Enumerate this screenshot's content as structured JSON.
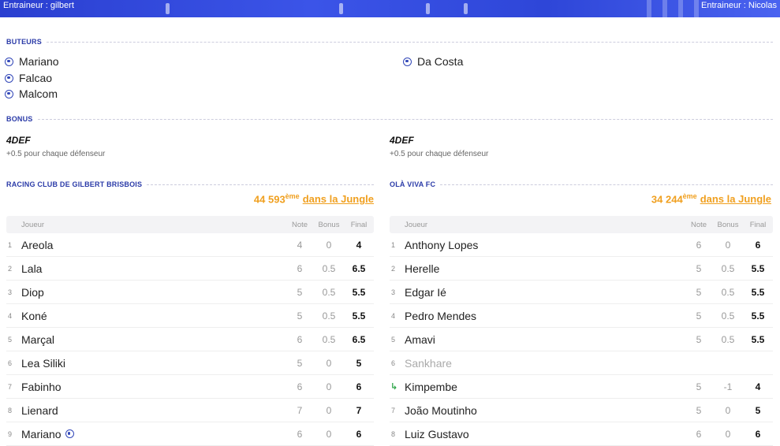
{
  "banner": {
    "coach_left": "Entraineur : gilbert",
    "coach_right": "Entraineur : Nicolas"
  },
  "sections": {
    "scorers": "BUTEURS",
    "bonus": "BONUS"
  },
  "scorers": {
    "left": [
      "Mariano",
      "Falcao",
      "Malcom"
    ],
    "right": [
      "Da Costa"
    ]
  },
  "bonus": {
    "left": {
      "name": "4DEF",
      "desc": "+0.5 pour chaque défenseur"
    },
    "right": {
      "name": "4DEF",
      "desc": "+0.5 pour chaque défenseur"
    }
  },
  "teams": [
    {
      "name": "RACING CLUB DE GILBERT BRISBOIS",
      "rank_number": "44 593",
      "rank_suffix": "ème",
      "rank_link": "dans la Jungle",
      "headers": {
        "player": "Joueur",
        "note": "Note",
        "bonus": "Bonus",
        "final": "Final"
      },
      "rows": [
        {
          "num": "1",
          "name": "Areola",
          "note": "4",
          "bonus": "0",
          "final": "4"
        },
        {
          "num": "2",
          "name": "Lala",
          "note": "6",
          "bonus": "0.5",
          "final": "6.5"
        },
        {
          "num": "3",
          "name": "Diop",
          "note": "5",
          "bonus": "0.5",
          "final": "5.5"
        },
        {
          "num": "4",
          "name": "Koné",
          "note": "5",
          "bonus": "0.5",
          "final": "5.5"
        },
        {
          "num": "5",
          "name": "Marçal",
          "note": "6",
          "bonus": "0.5",
          "final": "6.5"
        },
        {
          "num": "6",
          "name": "Lea Siliki",
          "note": "5",
          "bonus": "0",
          "final": "5"
        },
        {
          "num": "7",
          "name": "Fabinho",
          "note": "6",
          "bonus": "0",
          "final": "6"
        },
        {
          "num": "8",
          "name": "Lienard",
          "note": "7",
          "bonus": "0",
          "final": "7"
        },
        {
          "num": "9",
          "name": "Mariano",
          "note": "6",
          "bonus": "0",
          "final": "6"
        }
      ]
    },
    {
      "name": "OLÀ VIVA FC",
      "rank_number": "34 244",
      "rank_suffix": "ème",
      "rank_link": "dans la Jungle",
      "headers": {
        "player": "Joueur",
        "note": "Note",
        "bonus": "Bonus",
        "final": "Final"
      },
      "rows": [
        {
          "num": "1",
          "name": "Anthony Lopes",
          "note": "6",
          "bonus": "0",
          "final": "6"
        },
        {
          "num": "2",
          "name": "Herelle",
          "note": "5",
          "bonus": "0.5",
          "final": "5.5"
        },
        {
          "num": "3",
          "name": "Edgar Ié",
          "note": "5",
          "bonus": "0.5",
          "final": "5.5"
        },
        {
          "num": "4",
          "name": "Pedro Mendes",
          "note": "5",
          "bonus": "0.5",
          "final": "5.5"
        },
        {
          "num": "5",
          "name": "Amavi",
          "note": "5",
          "bonus": "0.5",
          "final": "5.5"
        },
        {
          "num": "6",
          "name": "Sankhare",
          "note": "",
          "bonus": "",
          "final": ""
        },
        {
          "num": "",
          "name": "Kimpembe",
          "note": "5",
          "bonus": "-1",
          "final": "4"
        },
        {
          "num": "7",
          "name": "João Moutinho",
          "note": "5",
          "bonus": "0",
          "final": "5"
        },
        {
          "num": "8",
          "name": "Luiz Gustavo",
          "note": "6",
          "bonus": "0",
          "final": "6"
        }
      ]
    }
  ]
}
